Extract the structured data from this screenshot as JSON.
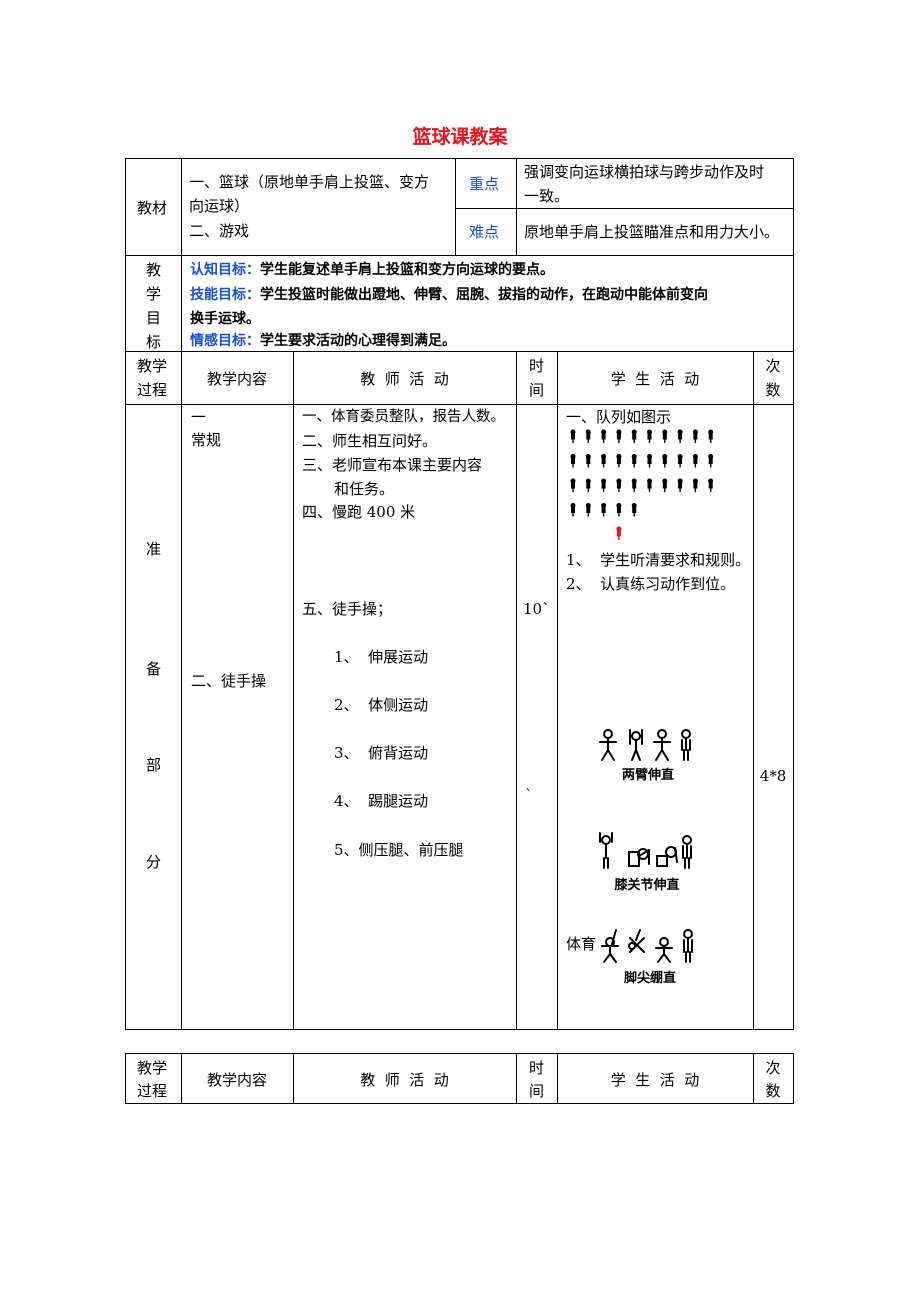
{
  "title": "篮球课教案",
  "info": {
    "material_label": "教材",
    "material_text": [
      "一、篮球（原地单手肩上投篮、变方",
      "向运球）",
      "二、游戏"
    ],
    "key_label": "重点",
    "key_text": [
      "强调变向运球横拍球与跨步动作及时",
      "一致。"
    ],
    "hard_label": "难点",
    "hard_text": "原地单手肩上投篮瞄准点和用力大小。"
  },
  "goals": {
    "label": [
      "教",
      "学",
      "目",
      "标"
    ],
    "cognitive_label": "认知目标：",
    "cognitive_text": "学生能复述单手肩上投篮和变方向运球的要点。",
    "skill_label": "技能目标：",
    "skill_text_1": "学生投篮时能做出蹬地、伸臂、屈腕、拔指的动作，在跑动中能体前变向",
    "skill_text_2": "换手运球。",
    "emotion_label": "情感目标：",
    "emotion_text": "学生要求活动的心理得到满足。"
  },
  "header": {
    "process": [
      "教学",
      "过程"
    ],
    "content": "教学内容",
    "teacher": "教  师  活  动",
    "time": [
      "时",
      "间"
    ],
    "student": "学  生  活  动",
    "count": [
      "次",
      "数"
    ]
  },
  "prep": {
    "section": [
      "准",
      "备",
      "部",
      "分"
    ],
    "content_1": [
      "一",
      "常规"
    ],
    "content_2": "二、徒手操",
    "teacher_items": [
      "一、体育委员整队，报告人数。",
      "二、师生相互问好。",
      "三、老师宣布本课主要内容",
      "和任务。",
      "四、慢跑 400 米",
      "五、徒手操；",
      "1、  伸展运动",
      "2、  体侧运动",
      "3、  俯背运动",
      "4、  踢腿运动",
      "5、侧压腿、前压腿"
    ],
    "time": "10`",
    "time_mark": "`",
    "student_items": [
      "一、队列如图示",
      "1、  学生听清要求和规则。",
      "2、  认真练习动作到位。"
    ],
    "figure_captions": [
      "两臂伸直",
      "膝关节伸直",
      "体育",
      "脚尖绷直"
    ],
    "count": "4*8",
    "formation_rows": [
      10,
      10,
      10,
      5
    ],
    "teacher_color": "#e8141f"
  }
}
